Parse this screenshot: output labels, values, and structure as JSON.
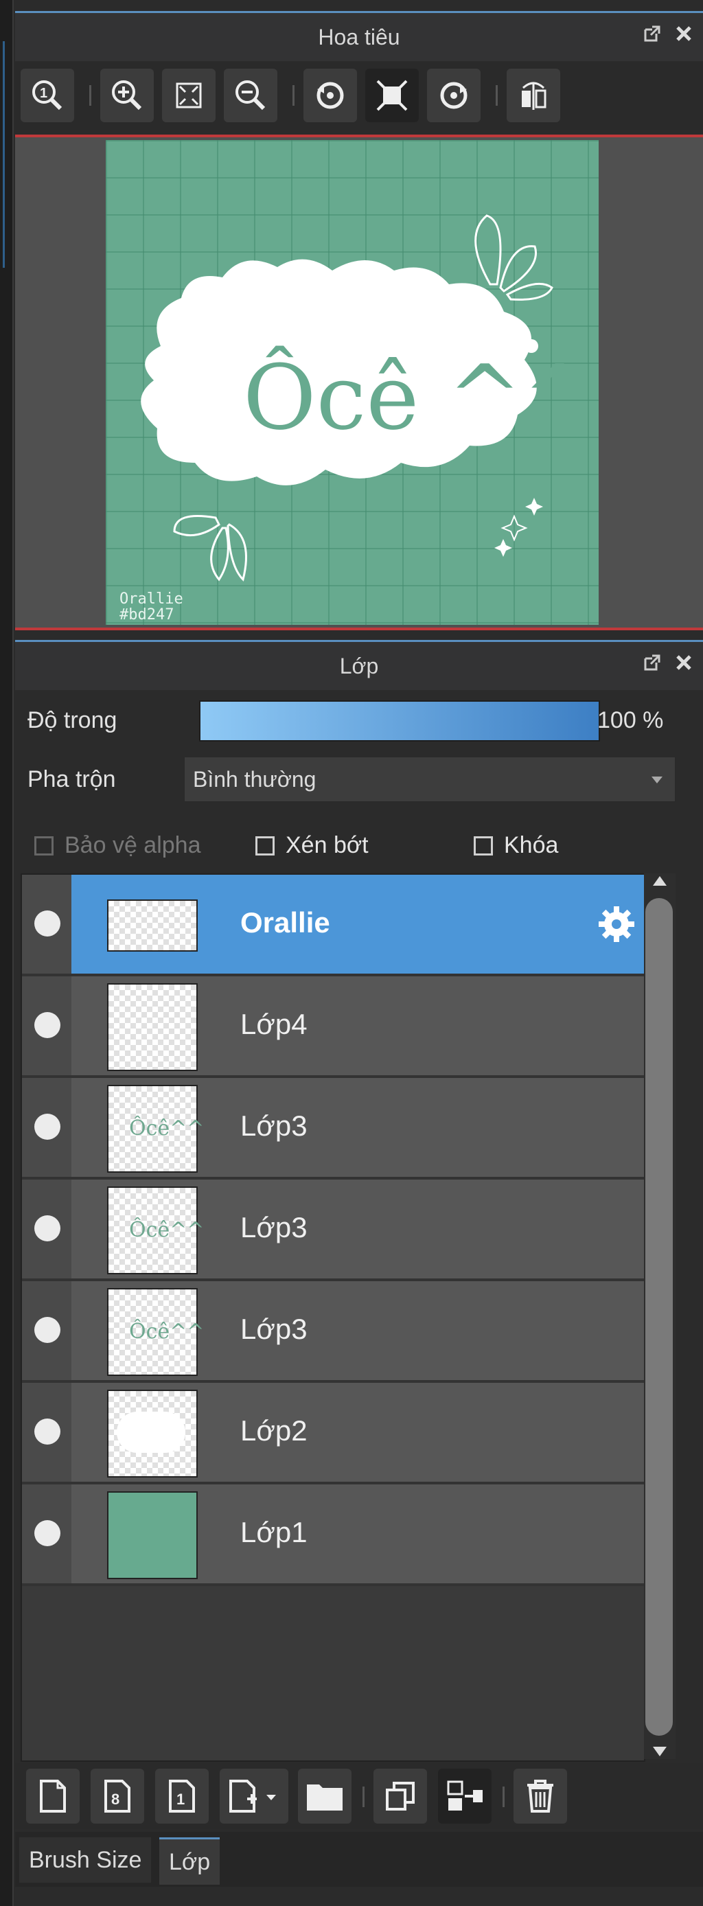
{
  "navigator": {
    "title": "Hoa tiêu"
  },
  "artwork": {
    "title_text": "Ôcê ^^",
    "signature": "Orallie",
    "hex_code": "#bd247",
    "background_color": "#67aa8f"
  },
  "layer_panel": {
    "title": "Lớp",
    "opacity_label": "Độ trong",
    "opacity_value": "100 %",
    "opacity_fraction": 1.0,
    "blend_label": "Pha trộn",
    "blend_value": "Bình thường",
    "protect_alpha_label": "Bảo vệ alpha",
    "clipping_label": "Xén bớt",
    "lock_label": "Khóa",
    "layers": [
      {
        "name": "Orallie",
        "active": true
      },
      {
        "name": "Lớp4",
        "active": false
      },
      {
        "name": "Lớp3",
        "active": false
      },
      {
        "name": "Lớp3",
        "active": false
      },
      {
        "name": "Lớp3",
        "active": false
      },
      {
        "name": "Lớp2",
        "active": false
      },
      {
        "name": "Lớp1",
        "active": false
      }
    ]
  },
  "thumbnails": {
    "mini_text": "Ôcê^^"
  },
  "bottom_tabs": {
    "brush_size": "Brush Size",
    "layer": "Lớp"
  },
  "colors": {
    "accent_blue": "#4c96d8",
    "divider_red": "#c0393b"
  }
}
